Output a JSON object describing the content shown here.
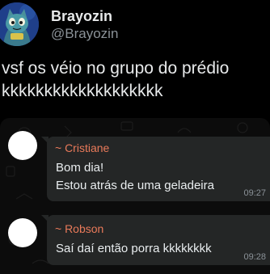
{
  "tweet": {
    "author": {
      "display_name": "Brayozin",
      "handle": "@Brayozin"
    },
    "text_lines": [
      "vsf os véio no grupo do prédio",
      "kkkkkkkkkkkkkkkkkkk"
    ]
  },
  "chat": {
    "messages": [
      {
        "sender": "~ Cristiane",
        "lines": [
          "Bom dia!",
          "Estou atrás de uma geladeira"
        ],
        "time": "09:27"
      },
      {
        "sender": "~ Robson",
        "lines": [
          "Saí daí então porra kkkkkkkk"
        ],
        "time": "09:28"
      }
    ]
  },
  "colors": {
    "background": "#000000",
    "bubble": "#242626",
    "sender_name": "#e97a5a",
    "timestamp": "#8b9298"
  },
  "icons": {
    "tweet_author_avatar": "cartoon-cat-avatar-icon",
    "contact_avatar": "blank-avatar-icon"
  }
}
